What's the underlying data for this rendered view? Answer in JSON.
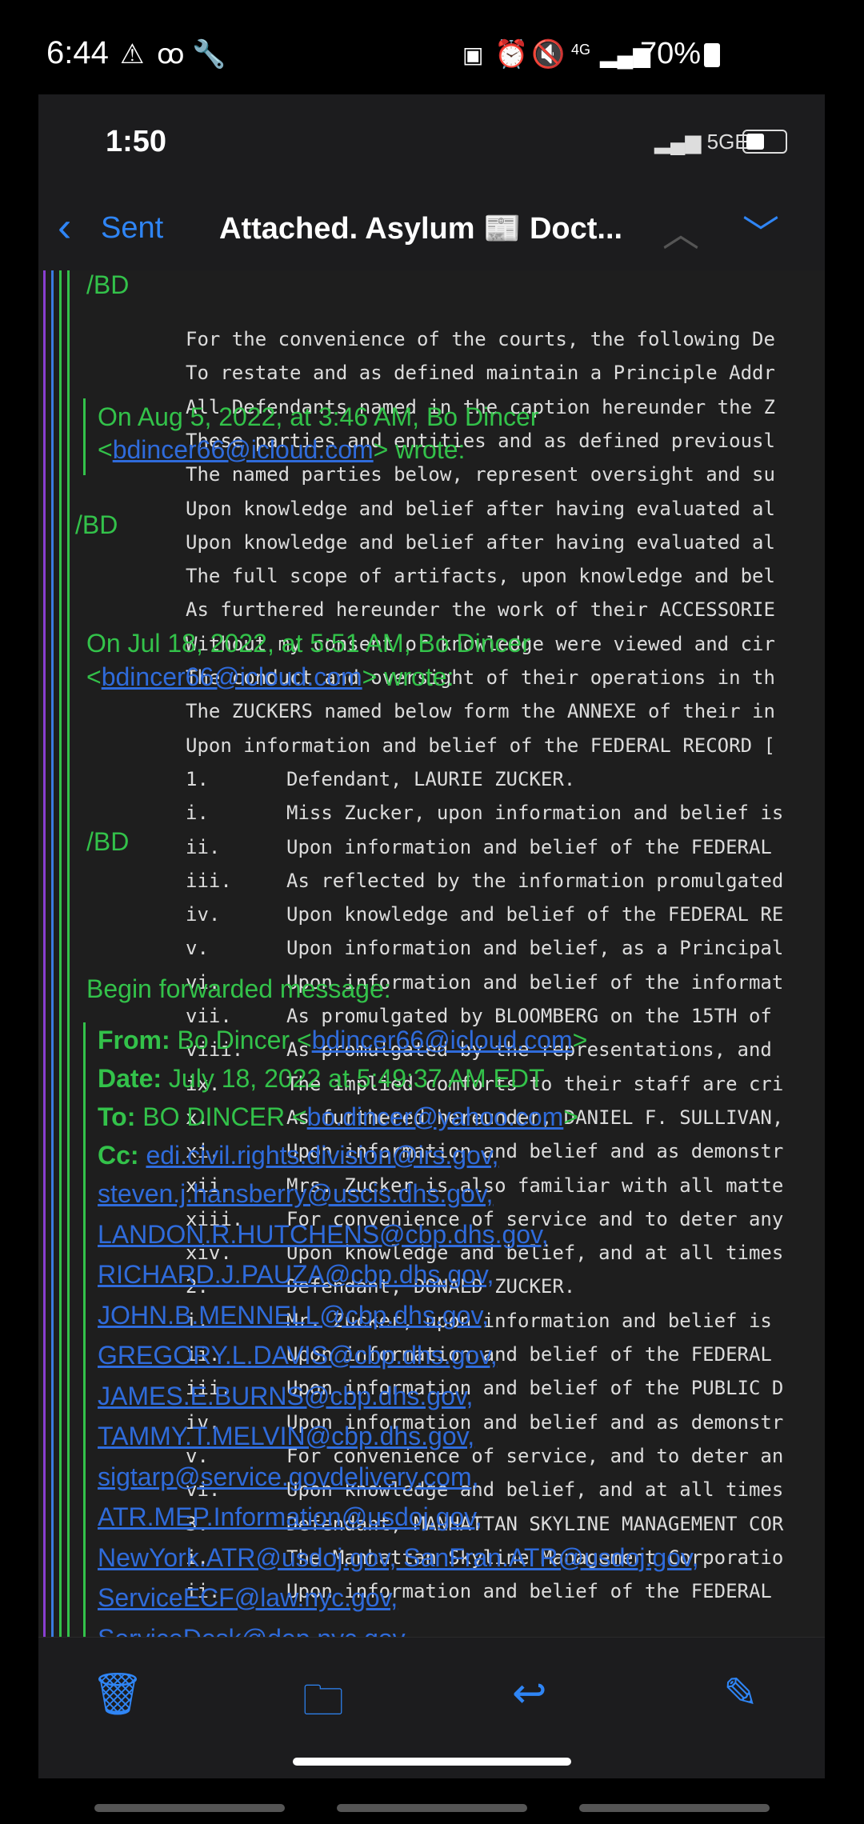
{
  "outer_status": {
    "time": "6:44",
    "left_icons": [
      "warning-icon",
      "voicemail-icon",
      "wrench-icon"
    ],
    "right_icons": [
      "nfc-icon",
      "alarm-icon",
      "mute-icon",
      "4g-icon",
      "signal-icon"
    ],
    "battery_pct": "70%"
  },
  "inner_status": {
    "time": "1:50",
    "network": "5GE"
  },
  "nav": {
    "back_label": "Sent",
    "subject": "Attached.  Asylum 📰 Doct..."
  },
  "email": {
    "sig1": "/BD",
    "on1_line1": "On Aug 5, 2022, at 3:46 AM, Bo Dincer",
    "on1_email": "bdincer66@icloud.com",
    "on1_wrote": "wrote:",
    "sig2": "/BD",
    "on2_line1": "On Jul 18, 2022, at 5:51 AM, Bo Dincer",
    "on2_email": "bdincer66@icloud.com",
    "on2_wrote": "wrote:",
    "sig3": "/BD",
    "begin_fwd": "Begin forwarded message:",
    "from_label": "From:",
    "from_name": "Bo Dincer",
    "from_email": "bdincer66@icloud.com",
    "date_label": "Date:",
    "date_value": "July 18, 2022 at 5:49:37 AM EDT",
    "to_label": "To:",
    "to_name": "BO DINCER",
    "to_email": "bo.dincer@yahoo.com",
    "cc_label": "Cc:",
    "cc_first": "edi.civil.rights.division@irs.gov,",
    "cc": [
      "steven.j.hansberry@uscis.dhs.gov,",
      "LANDON.R.HUTCHENS@cbp.dhs.gov,",
      "RICHARD.J.PAUZA@cbp.dhs.gov,",
      "JOHN.B.MENNELL@cbp.dhs.gov,",
      "GREGORY.L.DAVIS@cbp.dhs.gov,",
      "JAMES.E.BURNS@cbp.dhs.gov,",
      "TAMMY.T.MELVIN@cbp.dhs.gov,",
      "sigtarp@service.govdelivery.com,",
      "ATR.MEP.Information@usdoj.gov,",
      "NewYork.ATR@usdoj.gov, SanFran.ATR@usdoj.gov,",
      "ServiceECF@law.nyc.gov,",
      "ServiceDesk@dep.nyc.gov"
    ],
    "doc_lines": [
      {
        "n": "",
        "t": "For the convenience of the courts, the following De"
      },
      {
        "n": "",
        "t": "To restate and as defined maintain a Principle Addr"
      },
      {
        "n": "",
        "t": "All Defendants named in the caption hereunder the Z"
      },
      {
        "n": "",
        "t": "These parties and entities and as defined previousl"
      },
      {
        "n": "",
        "t": "The named parties below, represent oversight and su"
      },
      {
        "n": "",
        "t": "Upon knowledge and belief after having evaluated al"
      },
      {
        "n": "",
        "t": "Upon knowledge and belief after having evaluated al"
      },
      {
        "n": "",
        "t": "The full scope of artifacts, upon knowledge and bel"
      },
      {
        "n": "",
        "t": "As furthered hereunder the work of their ACCESSORIE"
      },
      {
        "n": "",
        "t": "Without my consent or knowledge were viewed and cir"
      },
      {
        "n": "",
        "t": "The conduct and oversight of their operations in th"
      },
      {
        "n": "",
        "t": "The ZUCKERS named below form the ANNEXE of their in"
      },
      {
        "n": "",
        "t": "Upon information and belief of the FEDERAL RECORD ["
      },
      {
        "n": "1.",
        "t": "Defendant, LAURIE ZUCKER."
      },
      {
        "n": "i.",
        "t": "Miss Zucker, upon information and belief is"
      },
      {
        "n": "ii.",
        "t": "Upon information and belief of the FEDERAL"
      },
      {
        "n": "iii.",
        "t": "As reflected by the information promulgated"
      },
      {
        "n": "iv.",
        "t": "Upon knowledge and belief of the FEDERAL RE"
      },
      {
        "n": "v.",
        "t": "Upon information and belief, as a Principal"
      },
      {
        "n": "vi.",
        "t": "Upon information and belief of the informat"
      },
      {
        "n": "vii.",
        "t": "As promulgated by BLOOMBERG on the 15TH of"
      },
      {
        "n": "viii.",
        "t": "As promulgated by the representations, and"
      },
      {
        "n": "ix.",
        "t": "The implied comforts to their staff are cri"
      },
      {
        "n": "x.",
        "t": "As furthered hereunder, DANIEL F. SULLIVAN,"
      },
      {
        "n": "xi.",
        "t": "Upon information and belief and as demonstr"
      },
      {
        "n": "xii.",
        "t": "Mrs. Zucker is also familiar with all matte"
      },
      {
        "n": "xiii.",
        "t": "For convenience of service and to deter any"
      },
      {
        "n": "xiv.",
        "t": "Upon knowledge and belief, and at all times"
      },
      {
        "n": "2.",
        "t": "Defendant, DONALD ZUCKER."
      },
      {
        "n": "i.",
        "t": "Mr. Zucker, upon information and belief is"
      },
      {
        "n": "ii.",
        "t": "Upon information and belief of the FEDERAL"
      },
      {
        "n": "iii.",
        "t": "Upon information and belief of the PUBLIC D"
      },
      {
        "n": "iv.",
        "t": "Upon information and belief and as demonstr"
      },
      {
        "n": "v.",
        "t": "For convenience of service, and to deter an"
      },
      {
        "n": "vi.",
        "t": "Upon knowledge and belief, and at all times"
      },
      {
        "n": "3.",
        "t": "Defendant, MANHATTAN SKYLINE MANAGEMENT COR"
      },
      {
        "n": "i.",
        "t": "The Manhattan Skyline Management Corporatio"
      },
      {
        "n": "ii.",
        "t": "Upon information and belief of the FEDERAL"
      }
    ]
  },
  "toolbar": [
    "trash-icon",
    "folder-icon",
    "reply-icon",
    "compose-icon"
  ],
  "colors": {
    "accent": "#2f85f5",
    "quote_green": "#33c24a",
    "link": "#2f6bdb"
  }
}
